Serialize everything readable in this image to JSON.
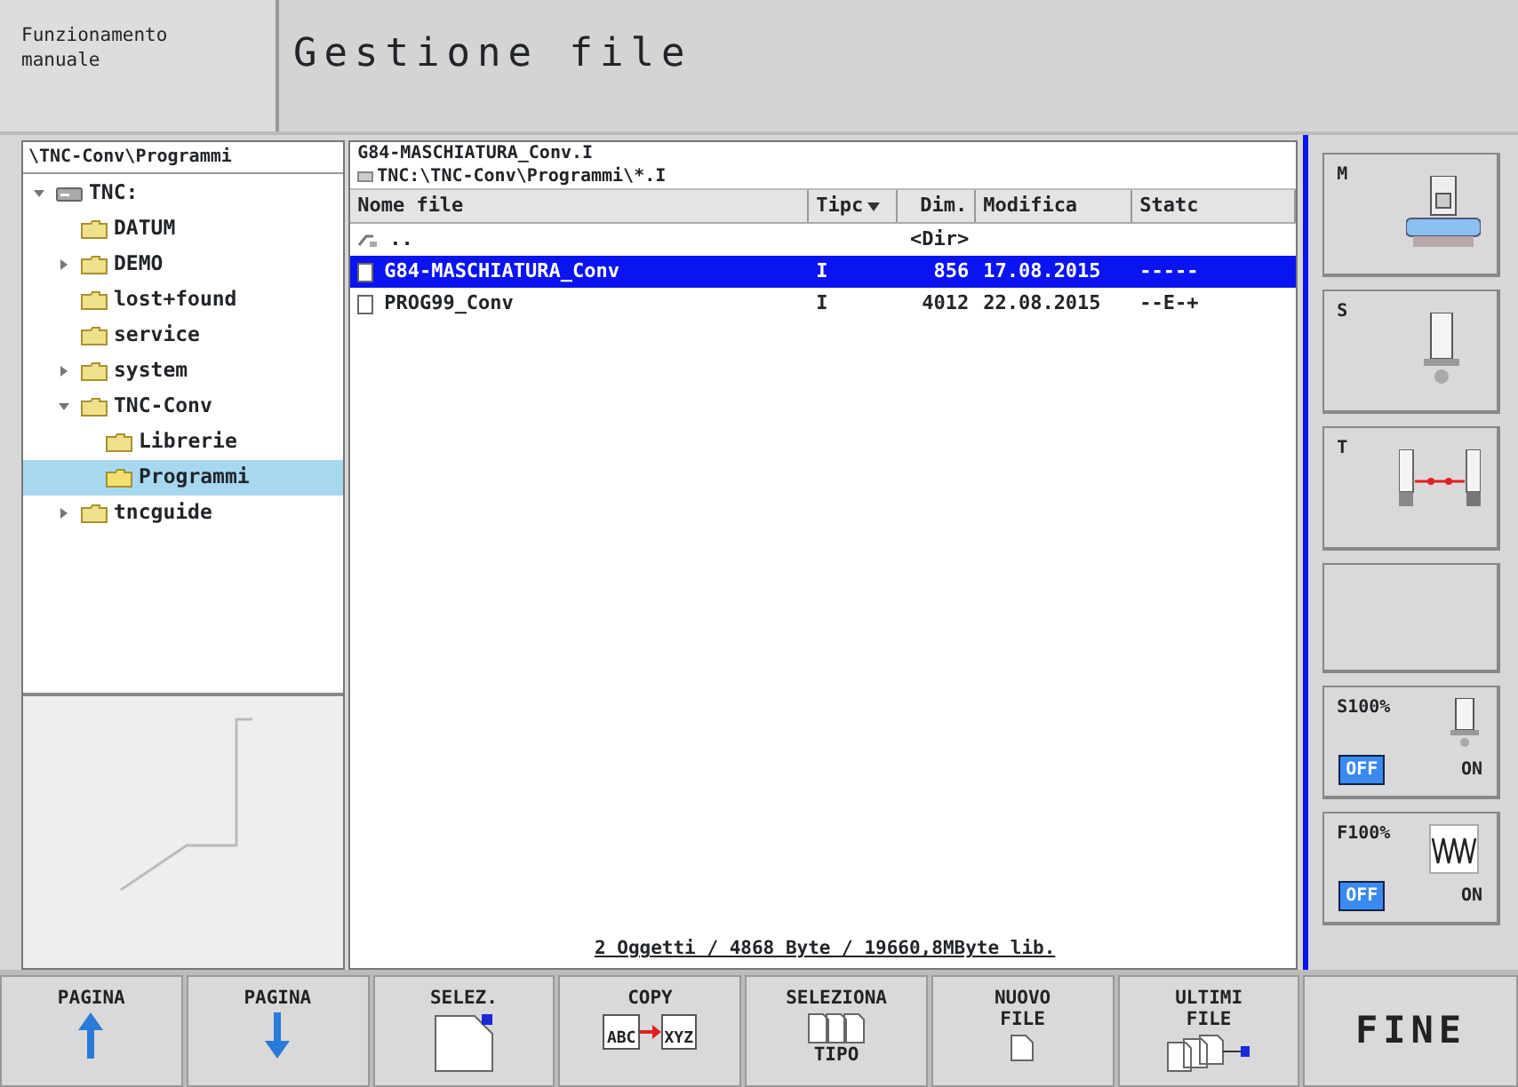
{
  "header": {
    "mode": "Funzionamento manuale",
    "title": "Gestione file"
  },
  "tree": {
    "path": "\\TNC-Conv\\Programmi",
    "items": [
      {
        "label": "TNC:",
        "kind": "drive",
        "expanded": true,
        "selected": false,
        "children": [
          {
            "label": "DATUM",
            "kind": "folder",
            "selected": false
          },
          {
            "label": "DEMO",
            "kind": "folder",
            "expanded": false,
            "selected": false
          },
          {
            "label": "lost+found",
            "kind": "folder",
            "selected": false
          },
          {
            "label": "service",
            "kind": "folder",
            "selected": false
          },
          {
            "label": "system",
            "kind": "folder",
            "expanded": false,
            "selected": false
          },
          {
            "label": "TNC-Conv",
            "kind": "folder",
            "expanded": true,
            "selected": false,
            "children": [
              {
                "label": "Librerie",
                "kind": "folder",
                "selected": false
              },
              {
                "label": "Programmi",
                "kind": "folder",
                "selected": true
              }
            ]
          },
          {
            "label": "tncguide",
            "kind": "folder",
            "expanded": false,
            "selected": false
          }
        ]
      }
    ]
  },
  "files": {
    "current": "G84-MASCHIATURA_Conv.I",
    "filter": "TNC:\\TNC-Conv\\Programmi\\*.I",
    "columns": [
      "Nome file",
      "Tipc",
      "Dim.",
      "Modifica",
      "Statc"
    ],
    "rows": [
      {
        "kind": "parent",
        "name": "..",
        "type": "",
        "size": "<Dir>",
        "modified": "",
        "status": "",
        "selected": false
      },
      {
        "kind": "file",
        "name": "G84-MASCHIATURA_Conv",
        "type": "I",
        "size": "856",
        "modified": "17.08.2015",
        "status": "-----",
        "selected": true
      },
      {
        "kind": "file",
        "name": "PROG99_Conv",
        "type": "I",
        "size": "4012",
        "modified": "22.08.2015",
        "status": "--E-+",
        "selected": false
      }
    ],
    "status": "2 Oggetti / 4868 Byte / 19660,8MByte lib."
  },
  "side_keys": [
    {
      "kind": "machine",
      "label": "M"
    },
    {
      "kind": "spindle",
      "label": "S"
    },
    {
      "kind": "tool",
      "label": "T"
    },
    {
      "kind": "empty"
    },
    {
      "kind": "spindle_override",
      "label": "S100%",
      "off": "OFF",
      "on": "ON",
      "active": false
    },
    {
      "kind": "feed_override",
      "label": "F100%",
      "off": "OFF",
      "on": "ON",
      "active": false
    }
  ],
  "soft_keys": [
    {
      "kind": "up",
      "lines": [
        "PAGINA"
      ]
    },
    {
      "kind": "down",
      "lines": [
        "PAGINA"
      ]
    },
    {
      "kind": "select",
      "lines": [
        "SELEZ."
      ]
    },
    {
      "kind": "copy",
      "lines": [
        "COPY"
      ],
      "from": "ABC",
      "to": "XYZ"
    },
    {
      "kind": "type",
      "lines": [
        "SELEZIONA",
        "TIPO"
      ]
    },
    {
      "kind": "new",
      "lines": [
        "NUOVO",
        "FILE"
      ]
    },
    {
      "kind": "recent",
      "lines": [
        "ULTIMI",
        "FILE"
      ]
    },
    {
      "kind": "end",
      "lines": [
        "FINE"
      ]
    }
  ]
}
